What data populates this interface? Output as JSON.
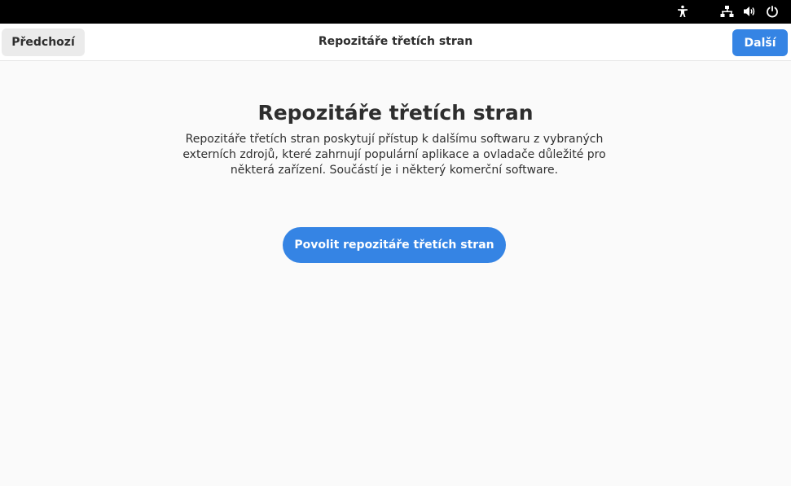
{
  "top_bar": {
    "icons": [
      "accessibility-icon",
      "network-wired-icon",
      "volume-icon",
      "power-icon"
    ]
  },
  "header": {
    "previous_label": "Předchozí",
    "title": "Repozitáře třetích stran",
    "next_label": "Další"
  },
  "main": {
    "heading": "Repozitáře třetích stran",
    "description": "Repozitáře třetích stran poskytují přístup k dalšímu softwaru z vybraných externích zdrojů, které zahrnují populární aplikace a ovladače důležité pro některá zařízení. Součástí je i některý komerční software.",
    "enable_button_label": "Povolit repozitáře třetích stran"
  },
  "colors": {
    "accent": "#3584e4",
    "top_bar": "#000000",
    "background": "#fafafa",
    "text": "#2e2e2e"
  }
}
